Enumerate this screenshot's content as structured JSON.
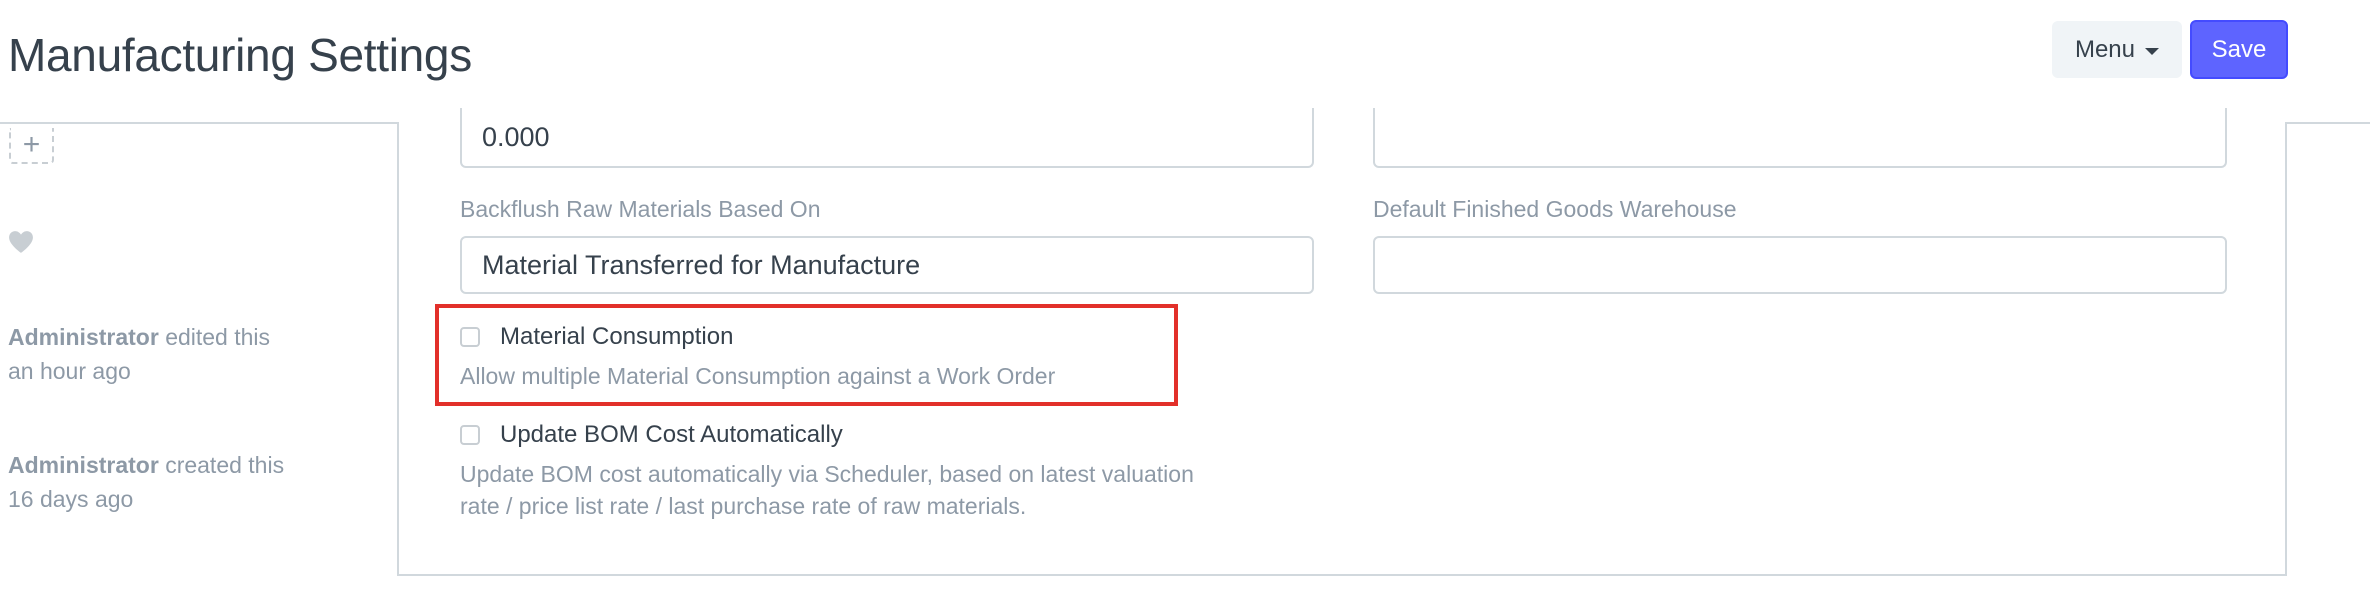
{
  "header": {
    "title": "Manufacturing Settings",
    "menu_label": "Menu",
    "save_label": "Save"
  },
  "sidebar": {
    "add_tag_symbol": "+",
    "timeline": [
      {
        "user": "Administrator",
        "action": "edited this",
        "time": "an hour ago"
      },
      {
        "user": "Administrator",
        "action": "created this",
        "time": "16 days ago"
      }
    ]
  },
  "form": {
    "top_left_value": "0.000",
    "top_right_value": "",
    "backflush": {
      "label": "Backflush Raw Materials Based On",
      "value": "Material Transferred for Manufacture"
    },
    "default_fg_warehouse": {
      "label": "Default Finished Goods Warehouse",
      "value": ""
    },
    "material_consumption": {
      "label": "Material Consumption",
      "help": "Allow multiple Material Consumption against a Work Order",
      "checked": false
    },
    "update_bom_cost": {
      "label": "Update BOM Cost Automatically",
      "help_line1": "Update BOM cost automatically via Scheduler, based on latest valuation",
      "help_line2": "rate / price list rate / last purchase rate of raw materials.",
      "checked": false
    }
  },
  "colors": {
    "primary": "#5e64ff",
    "highlight": "#e2302a",
    "muted_text": "#8d99a6",
    "border": "#d1d8dd"
  }
}
